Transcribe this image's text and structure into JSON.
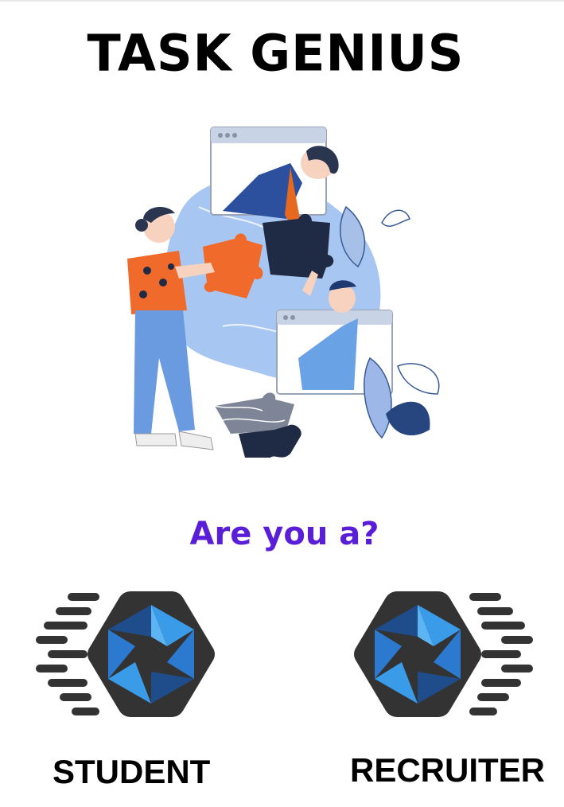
{
  "app": {
    "title": "TASK GENIUS"
  },
  "prompt": {
    "question": "Are you a?"
  },
  "roles": [
    {
      "id": "student",
      "label": "STUDENT",
      "icon": "camera-shutter-icon"
    },
    {
      "id": "recruiter",
      "label": "RECRUITER",
      "icon": "camera-shutter-icon"
    }
  ],
  "colors": {
    "title": "#000000",
    "question": "#5a1ed8",
    "icon_frame": "#333333",
    "icon_blue_dark": "#1f4d8c",
    "icon_blue_light": "#3a9be8"
  }
}
